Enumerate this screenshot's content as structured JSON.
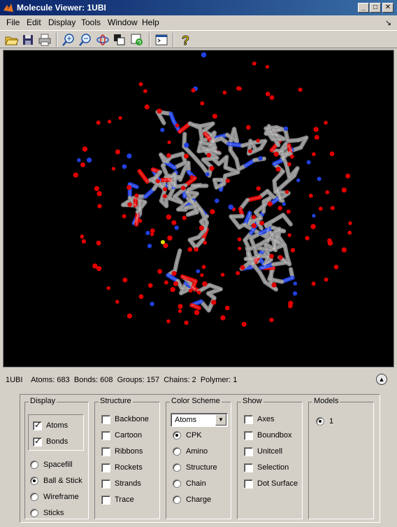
{
  "window": {
    "title": "Molecule Viewer: 1UBI",
    "controls": [
      "_",
      "□",
      "✕"
    ]
  },
  "menu": [
    "File",
    "Edit",
    "Display",
    "Tools",
    "Window",
    "Help"
  ],
  "toolbar_icons": [
    "open-icon",
    "save-icon",
    "print-icon",
    "zoom-in-icon",
    "zoom-out-icon",
    "rotate-icon",
    "copy-icon",
    "refresh-icon",
    "console-icon",
    "help-icon"
  ],
  "status": {
    "text": "1UBI    Atoms: 683  Bonds: 608  Groups: 157  Chains: 2  Polymer: 1"
  },
  "panels": {
    "display": {
      "title": "Display",
      "checks": [
        {
          "label": "Atoms",
          "checked": true
        },
        {
          "label": "Bonds",
          "checked": true
        }
      ],
      "radios": [
        {
          "label": "Spacefill",
          "on": false
        },
        {
          "label": "Ball & Stick",
          "on": true
        },
        {
          "label": "Wireframe",
          "on": false
        },
        {
          "label": "Sticks",
          "on": false
        }
      ]
    },
    "structure": {
      "title": "Structure",
      "checks": [
        {
          "label": "Backbone"
        },
        {
          "label": "Cartoon"
        },
        {
          "label": "Ribbons"
        },
        {
          "label": "Rockets"
        },
        {
          "label": "Strands"
        },
        {
          "label": "Trace"
        }
      ]
    },
    "color": {
      "title": "Color Scheme",
      "select_value": "Atoms",
      "radios": [
        {
          "label": "CPK",
          "on": true
        },
        {
          "label": "Amino",
          "on": false
        },
        {
          "label": "Structure",
          "on": false
        },
        {
          "label": "Chain",
          "on": false
        },
        {
          "label": "Charge",
          "on": false
        }
      ]
    },
    "show": {
      "title": "Show",
      "checks": [
        {
          "label": "Axes"
        },
        {
          "label": "Boundbox"
        },
        {
          "label": "Unitcell"
        },
        {
          "label": "Selection"
        },
        {
          "label": "Dot Surface"
        }
      ]
    },
    "models": {
      "title": "Models",
      "radios": [
        {
          "label": "1",
          "on": true
        }
      ]
    }
  },
  "colors": {
    "carbon": "#8c8c8c",
    "oxygen": "#e00000",
    "nitrogen": "#2040e0",
    "sulfur": "#e0e000",
    "background": "#000000"
  }
}
